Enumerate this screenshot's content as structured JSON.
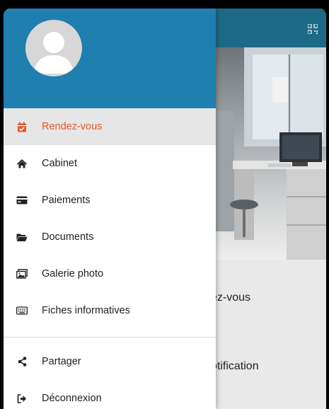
{
  "drawer": {
    "items": [
      {
        "label": "Rendez-vous",
        "icon": "calendar-check-icon",
        "active": true
      },
      {
        "label": "Cabinet",
        "icon": "home-icon"
      },
      {
        "label": "Paiements",
        "icon": "credit-card-icon"
      },
      {
        "label": "Documents",
        "icon": "folder-open-icon"
      },
      {
        "label": "Galerie photo",
        "icon": "images-icon"
      },
      {
        "label": "Fiches informatives",
        "icon": "keyboard-icon"
      }
    ],
    "secondary_items": [
      {
        "label": "Partager",
        "icon": "share-icon"
      },
      {
        "label": "Déconnexion",
        "icon": "sign-out-icon"
      }
    ]
  },
  "background": {
    "text_1": "ez-vous",
    "text_2": "otification"
  },
  "colors": {
    "drawer_header": "#1f7fae",
    "app_header": "#1e6a86",
    "accent": "#e8562a"
  }
}
